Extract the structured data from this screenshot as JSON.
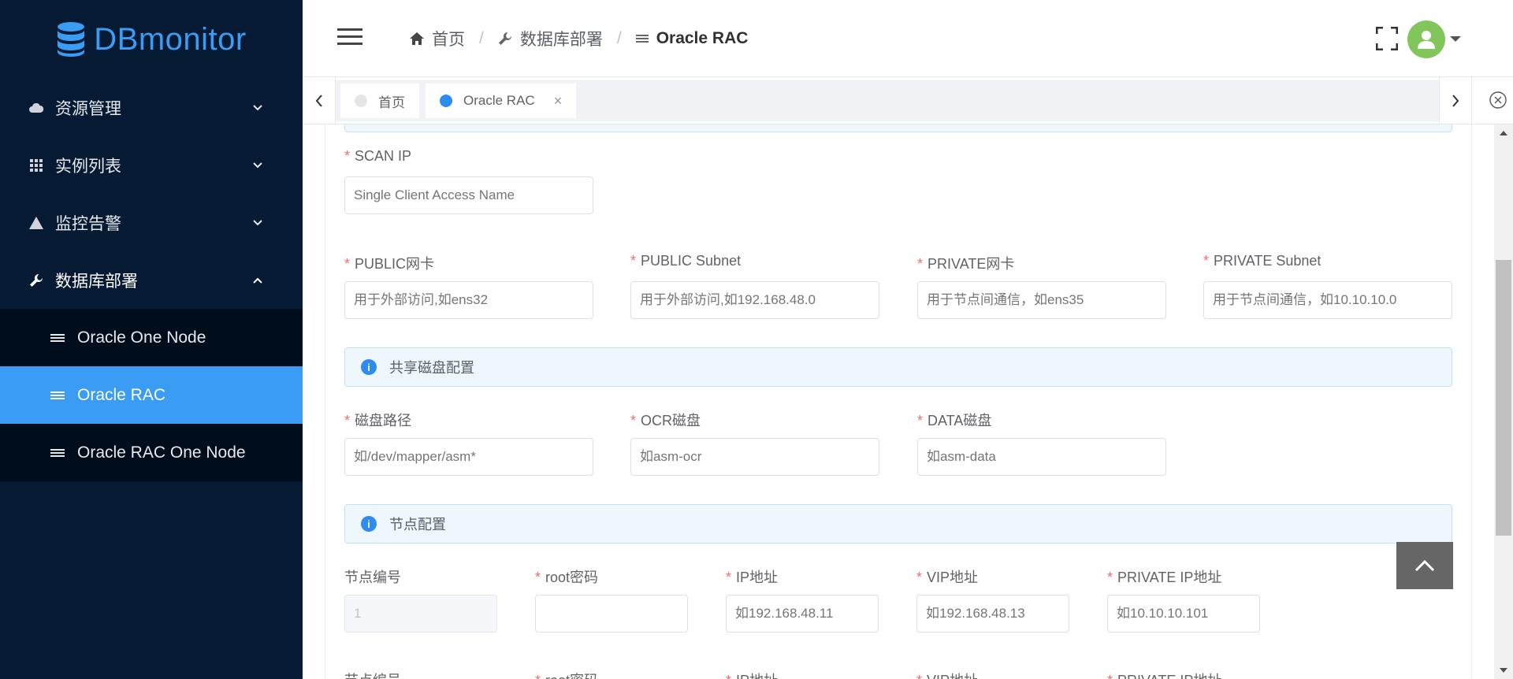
{
  "app": {
    "name": "DBmonitor"
  },
  "sidebar": {
    "items": [
      {
        "label": "资源管理",
        "icon": "cloud-icon"
      },
      {
        "label": "实例列表",
        "icon": "grid-icon"
      },
      {
        "label": "监控告警",
        "icon": "warning-icon"
      },
      {
        "label": "数据库部署",
        "icon": "wrench-icon"
      }
    ],
    "sub_items": [
      {
        "label": "Oracle One Node"
      },
      {
        "label": "Oracle RAC"
      },
      {
        "label": "Oracle RAC One Node"
      }
    ]
  },
  "breadcrumb": {
    "home": "首页",
    "section": "数据库部署",
    "current": "Oracle RAC"
  },
  "tabs": [
    {
      "label": "首页"
    },
    {
      "label": "Oracle RAC"
    }
  ],
  "form": {
    "scan_ip": {
      "label": "SCAN IP",
      "placeholder": "Single Client Access Name"
    },
    "public_nic": {
      "label": "PUBLIC网卡",
      "placeholder": "用于外部访问,如ens32"
    },
    "public_subnet": {
      "label": "PUBLIC Subnet",
      "placeholder": "用于外部访问,如192.168.48.0"
    },
    "private_nic": {
      "label": "PRIVATE网卡",
      "placeholder": "用于节点间通信，如ens35"
    },
    "private_subnet": {
      "label": "PRIVATE Subnet",
      "placeholder": "用于节点间通信，如10.10.10.0"
    },
    "shared_disk_title": "共享磁盘配置",
    "disk_path": {
      "label": "磁盘路径",
      "placeholder": "如/dev/mapper/asm*"
    },
    "ocr_disk": {
      "label": "OCR磁盘",
      "placeholder": "如asm-ocr"
    },
    "data_disk": {
      "label": "DATA磁盘",
      "placeholder": "如asm-data"
    },
    "node_config_title": "节点配置",
    "node_no": {
      "label": "节点编号",
      "value": "1"
    },
    "root_pw": {
      "label": "root密码",
      "placeholder": ""
    },
    "ip_addr": {
      "label": "IP地址",
      "placeholder": "如192.168.48.11"
    },
    "vip_addr": {
      "label": "VIP地址",
      "placeholder": "如192.168.48.13"
    },
    "private_ip": {
      "label": "PRIVATE IP地址",
      "placeholder": "如10.10.10.101"
    },
    "node2": {
      "node_no": "节点编号",
      "root_pw": "root密码",
      "ip_addr": "IP地址",
      "vip_addr": "VIP地址",
      "private_ip": "PRIVATE IP地址"
    }
  },
  "colors": {
    "sidebar_bg": "#061a33",
    "accent": "#3a9cf2",
    "required": "#f56c6c",
    "avatar": "#82c55b"
  }
}
